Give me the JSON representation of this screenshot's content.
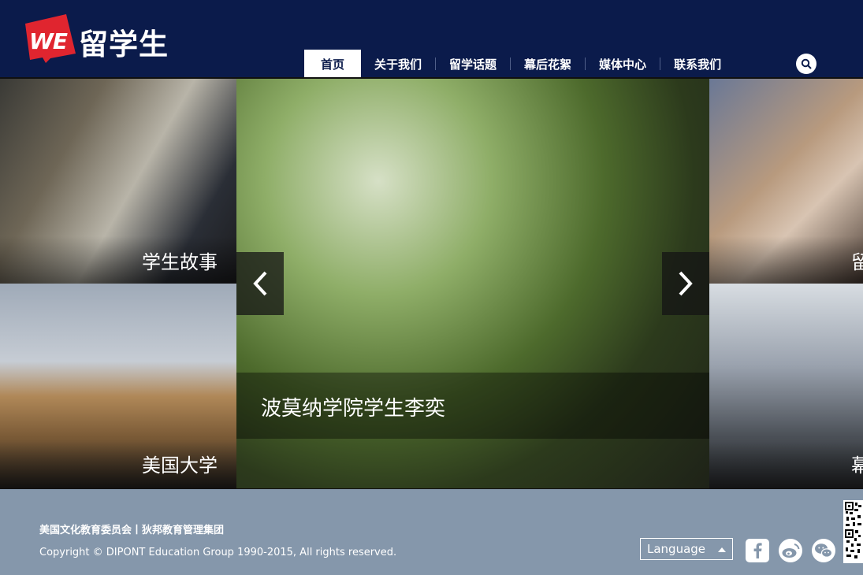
{
  "header": {
    "logo_badge": "WE",
    "logo_text": "留学生",
    "nav": [
      {
        "label": "首页",
        "active": true
      },
      {
        "label": "关于我们",
        "active": false
      },
      {
        "label": "留学话题",
        "active": false
      },
      {
        "label": "幕后花絮",
        "active": false
      },
      {
        "label": "媒体中心",
        "active": false
      },
      {
        "label": "联系我们",
        "active": false
      }
    ],
    "search_icon": "search-icon"
  },
  "banner": {
    "tiles": [
      {
        "label": "学生故事"
      },
      {
        "label": "美国大学"
      },
      {
        "label": "留"
      },
      {
        "label": "幕"
      }
    ],
    "main_caption": "波莫纳学院学生李奕",
    "prev_icon": "chevron-left-icon",
    "next_icon": "chevron-right-icon"
  },
  "footer": {
    "org_links": "美国文化教育委员会丨狄邦教育管理集团",
    "copyright": "Copyright © DIPONT Education Group 1990-2015, All rights reserved.",
    "language_label": "Language",
    "social_icons": [
      "facebook-icon",
      "weibo-icon",
      "wechat-icon"
    ]
  },
  "colors": {
    "header_bg": "#0b1b4b",
    "footer_bg": "#8597ab",
    "logo_red": "#e0252f"
  }
}
